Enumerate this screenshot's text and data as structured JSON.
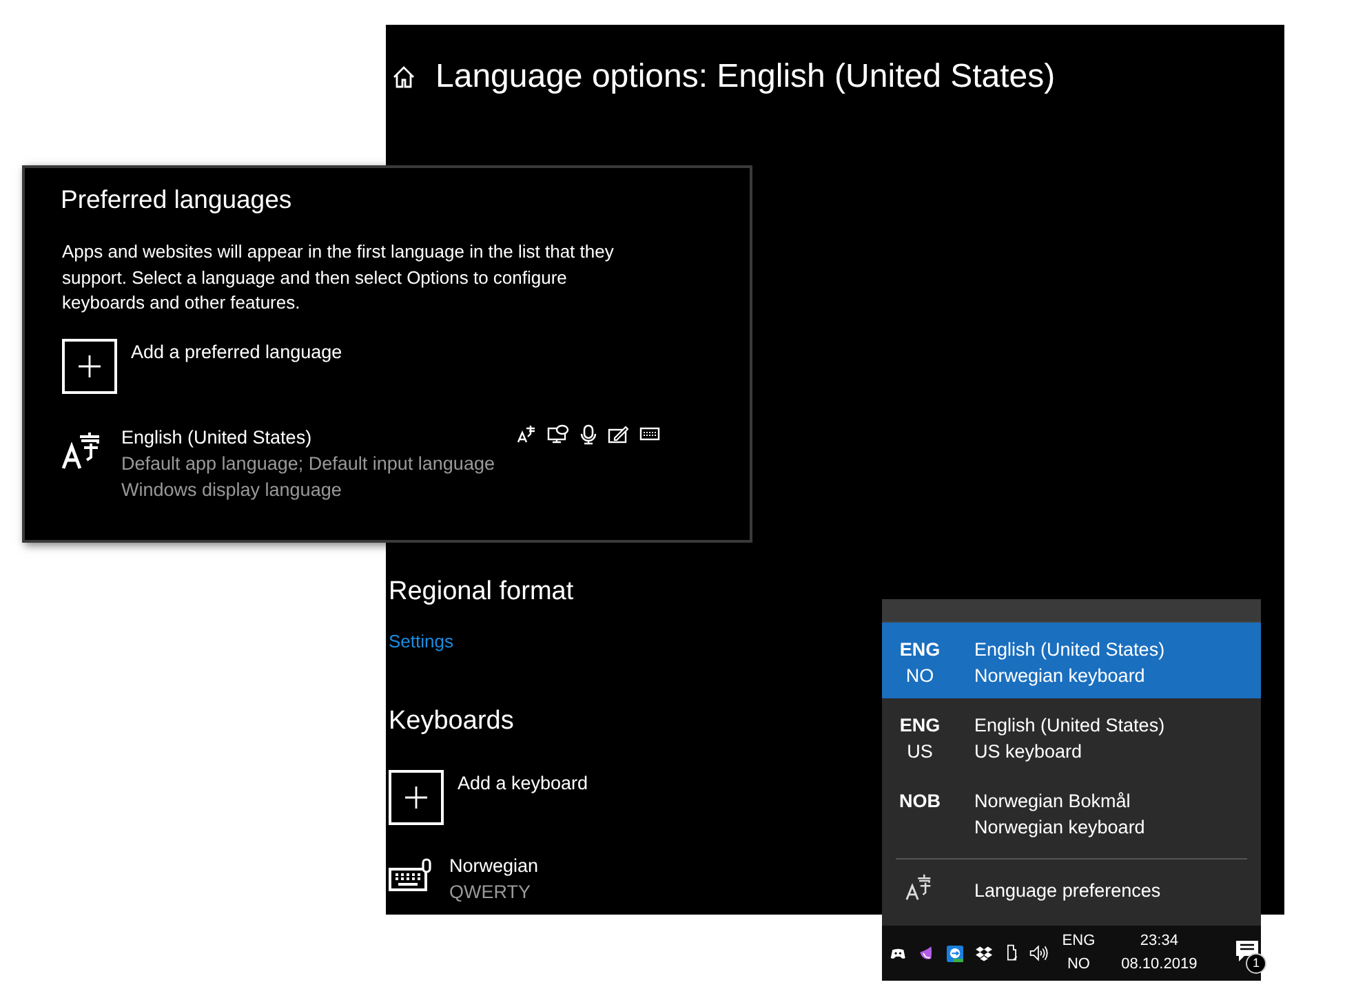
{
  "settings_window": {
    "title": "Language options: English (United States)",
    "regional_format": {
      "heading": "Regional format",
      "link": "Settings"
    },
    "keyboards": {
      "heading": "Keyboards",
      "add_label": "Add a keyboard",
      "items": [
        {
          "name": "Norwegian",
          "layout": "QWERTY"
        }
      ]
    }
  },
  "preferred_languages": {
    "title": "Preferred languages",
    "description": "Apps and websites will appear in the first language in the list that they support. Select a language and then select Options to configure keyboards and other features.",
    "add_label": "Add a preferred language",
    "languages": [
      {
        "name": "English (United States)",
        "details": [
          "Default app language; Default input language",
          "Windows display language"
        ]
      }
    ]
  },
  "input_flyout": {
    "items": [
      {
        "code": "ENG",
        "region": "NO",
        "language": "English (United States)",
        "keyboard": "Norwegian keyboard",
        "selected": true
      },
      {
        "code": "ENG",
        "region": "US",
        "language": "English (United States)",
        "keyboard": "US keyboard",
        "selected": false
      },
      {
        "code": "NOB",
        "language": "Norwegian Bokmål",
        "keyboard": "Norwegian keyboard",
        "selected": false
      }
    ],
    "footer_label": "Language preferences"
  },
  "taskbar": {
    "input_code": "ENG",
    "input_region": "NO",
    "time": "23:34",
    "date": "08.10.2019",
    "notification_count": "1"
  }
}
